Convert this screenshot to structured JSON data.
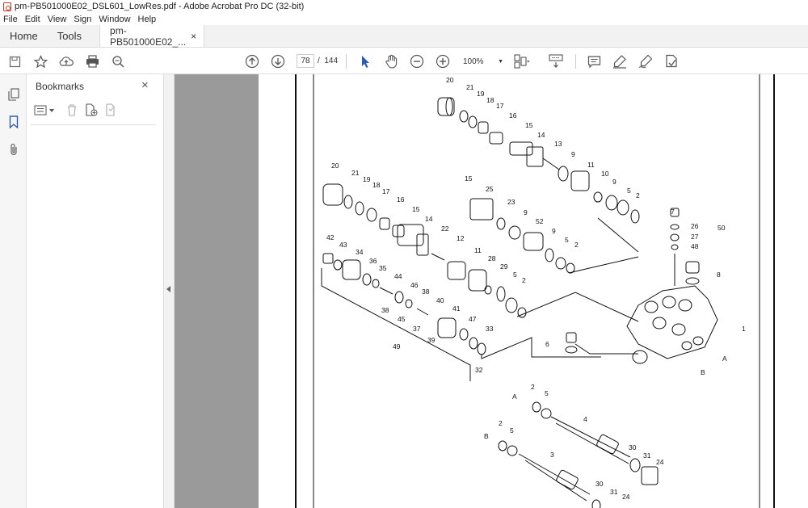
{
  "window": {
    "title": "pm-PB501000E02_DSL601_LowRes.pdf - Adobe Acrobat Pro DC (32-bit)"
  },
  "menu": [
    "File",
    "Edit",
    "View",
    "Sign",
    "Window",
    "Help"
  ],
  "tabs": {
    "home": "Home",
    "tools": "Tools",
    "document": "pm-PB501000E02_...",
    "close": "×"
  },
  "toolbar": {
    "page_current": "78",
    "page_separator": "/",
    "page_total": "144",
    "zoom": "100%"
  },
  "bookmarks": {
    "title": "Bookmarks",
    "close": "×"
  },
  "diagram": {
    "labels": [
      "20",
      "21",
      "19",
      "18",
      "17",
      "16",
      "15",
      "14",
      "13",
      "9",
      "11",
      "10",
      "9",
      "5",
      "2",
      "20",
      "21",
      "19",
      "18",
      "17",
      "16",
      "15",
      "14",
      "15",
      "25",
      "23",
      "9",
      "52",
      "9",
      "5",
      "2",
      "22",
      "12",
      "11",
      "28",
      "29",
      "5",
      "2",
      "42",
      "43",
      "34",
      "36",
      "35",
      "44",
      "46",
      "38",
      "38",
      "45",
      "37",
      "40",
      "39",
      "41",
      "47",
      "33",
      "49",
      "32",
      "7",
      "26",
      "27",
      "48",
      "50",
      "8",
      "1",
      "6",
      "A",
      "B",
      "A",
      "2",
      "5",
      "4",
      "B",
      "2",
      "5",
      "3",
      "30",
      "31",
      "24",
      "30",
      "31",
      "24"
    ]
  }
}
